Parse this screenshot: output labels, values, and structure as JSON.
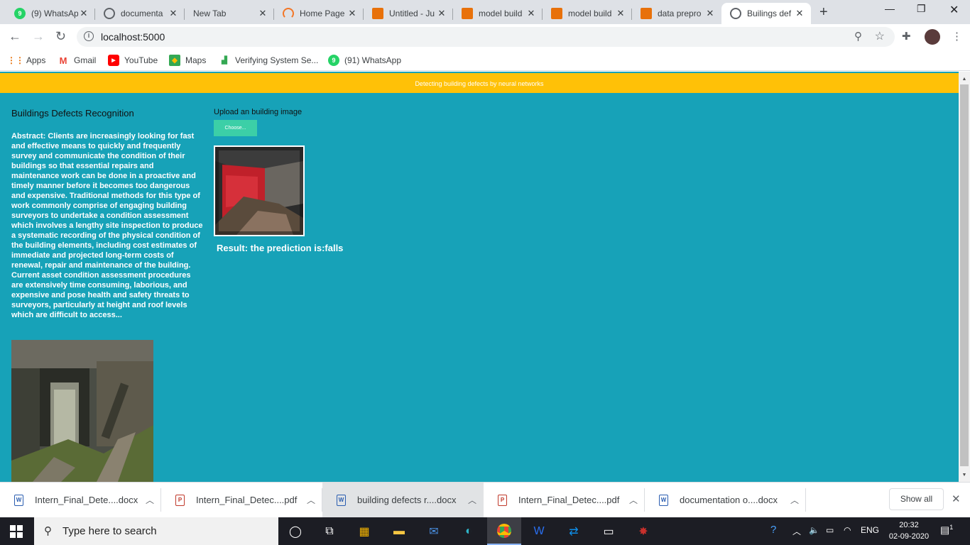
{
  "browser": {
    "tabs": [
      {
        "title": "(9) WhatsAp",
        "icon": "whatsapp-icon",
        "color": "#25d366"
      },
      {
        "title": "documenta",
        "icon": "globe-icon",
        "color": "#5f6368"
      },
      {
        "title": "New Tab",
        "icon": "",
        "color": ""
      },
      {
        "title": "Home Page",
        "icon": "jupyter-icon",
        "color": "#f37626"
      },
      {
        "title": "Untitled - Ju",
        "icon": "notebook-icon",
        "color": "#e8710a"
      },
      {
        "title": "model build",
        "icon": "notebook-icon",
        "color": "#e8710a"
      },
      {
        "title": "model build",
        "icon": "notebook-icon",
        "color": "#e8710a"
      },
      {
        "title": "data prepro",
        "icon": "notebook-icon",
        "color": "#e8710a"
      },
      {
        "title": "Builings def",
        "icon": "globe-icon",
        "color": "#5f6368"
      }
    ],
    "url": "localhost:5000",
    "bookmarks": [
      {
        "label": "Apps",
        "icon": "apps-grid-icon"
      },
      {
        "label": "Gmail",
        "icon": "gmail-icon"
      },
      {
        "label": "YouTube",
        "icon": "youtube-icon"
      },
      {
        "label": "Maps",
        "icon": "maps-icon"
      },
      {
        "label": "Verifying System Se...",
        "icon": "chart-icon"
      },
      {
        "label": "(91) WhatsApp",
        "icon": "whatsapp-icon"
      }
    ]
  },
  "page": {
    "banner": "Detecting building defects by neural networks",
    "title": "Buildings Defects Recognition",
    "abstract": "Abstract: Clients are increasingly looking for fast and effective means to quickly and frequently survey and communicate the condition of their buildings so that essential repairs and maintenance work can be done in a proactive and timely manner before it becomes too dangerous and expensive. Traditional methods for this type of work commonly comprise of engaging building surveyors to undertake a condition assessment which involves a lengthy site inspection to produce a systematic recording of the physical condition of the building elements, including cost estimates of immediate and projected long-term costs of renewal, repair and maintenance of the building. Current asset condition assessment procedures are extensively time consuming, laborious, and expensive and pose health and safety threats to surveyors, particularly at height and roof levels which are difficult to access...",
    "upload_label": "Upload an building image",
    "choose_button": "Choose...",
    "result": "Result: the prediction is:falls",
    "colors": {
      "background": "#17a2b8",
      "banner": "#ffc107",
      "button": "#3ccfa7"
    }
  },
  "downloads": {
    "items": [
      {
        "name": "Intern_Final_Dete....docx",
        "type": "doc"
      },
      {
        "name": "Intern_Final_Detec....pdf",
        "type": "pdf"
      },
      {
        "name": "building defects r....docx",
        "type": "doc"
      },
      {
        "name": "Intern_Final_Detec....pdf",
        "type": "pdf"
      },
      {
        "name": "documentation o....docx",
        "type": "doc"
      }
    ],
    "show_all": "Show all"
  },
  "taskbar": {
    "search_placeholder": "Type here to search",
    "language": "ENG",
    "time": "20:32",
    "date": "02-09-2020",
    "notification_count": "1"
  }
}
